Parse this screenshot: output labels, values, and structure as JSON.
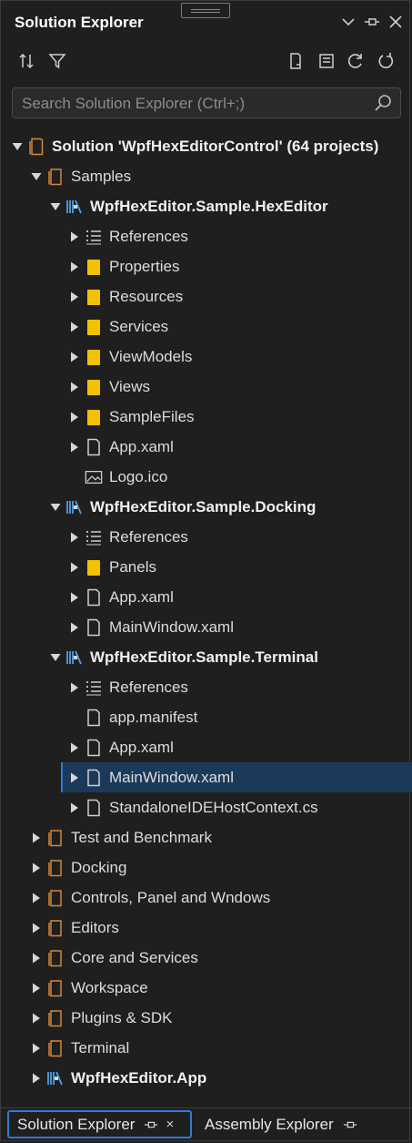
{
  "panel": {
    "title": "Solution Explorer"
  },
  "search": {
    "placeholder": "Search Solution Explorer (Ctrl+;)"
  },
  "tree": [
    {
      "label": "Solution 'WpfHexEditorControl' (64 projects)",
      "icon": "solution-icon",
      "expand": "open",
      "depth": 0,
      "bold": true
    },
    {
      "label": "Samples",
      "icon": "solution-folder-icon",
      "expand": "open",
      "depth": 1
    },
    {
      "label": "WpfHexEditor.Sample.HexEditor",
      "icon": "project-icon",
      "expand": "open",
      "depth": 2,
      "bold": true
    },
    {
      "label": "References",
      "icon": "references-icon",
      "expand": "closed",
      "depth": 3
    },
    {
      "label": "Properties",
      "icon": "folder-icon",
      "expand": "closed",
      "depth": 3
    },
    {
      "label": "Resources",
      "icon": "folder-icon",
      "expand": "closed",
      "depth": 3
    },
    {
      "label": "Services",
      "icon": "folder-icon",
      "expand": "closed",
      "depth": 3
    },
    {
      "label": "ViewModels",
      "icon": "folder-icon",
      "expand": "closed",
      "depth": 3
    },
    {
      "label": "Views",
      "icon": "folder-icon",
      "expand": "closed",
      "depth": 3
    },
    {
      "label": "SampleFiles",
      "icon": "folder-icon",
      "expand": "closed",
      "depth": 3
    },
    {
      "label": "App.xaml",
      "icon": "file-icon",
      "expand": "closed",
      "depth": 3
    },
    {
      "label": "Logo.ico",
      "icon": "image-file-icon",
      "expand": "none",
      "depth": 3
    },
    {
      "label": "WpfHexEditor.Sample.Docking",
      "icon": "project-icon",
      "expand": "open",
      "depth": 2,
      "bold": true
    },
    {
      "label": "References",
      "icon": "references-icon",
      "expand": "closed",
      "depth": 3
    },
    {
      "label": "Panels",
      "icon": "folder-icon",
      "expand": "closed",
      "depth": 3
    },
    {
      "label": "App.xaml",
      "icon": "file-icon",
      "expand": "closed",
      "depth": 3
    },
    {
      "label": "MainWindow.xaml",
      "icon": "file-icon",
      "expand": "closed",
      "depth": 3
    },
    {
      "label": "WpfHexEditor.Sample.Terminal",
      "icon": "project-icon",
      "expand": "open",
      "depth": 2,
      "bold": true
    },
    {
      "label": "References",
      "icon": "references-icon",
      "expand": "closed",
      "depth": 3
    },
    {
      "label": "app.manifest",
      "icon": "file-icon",
      "expand": "none",
      "depth": 3
    },
    {
      "label": "App.xaml",
      "icon": "file-icon",
      "expand": "closed",
      "depth": 3
    },
    {
      "label": "MainWindow.xaml",
      "icon": "file-icon",
      "expand": "closed",
      "depth": 3,
      "selected": true
    },
    {
      "label": "StandaloneIDEHostContext.cs",
      "icon": "file-icon",
      "expand": "closed",
      "depth": 3
    },
    {
      "label": "Test and Benchmark",
      "icon": "solution-folder-icon",
      "expand": "closed",
      "depth": 1
    },
    {
      "label": "Docking",
      "icon": "solution-folder-icon",
      "expand": "closed",
      "depth": 1
    },
    {
      "label": "Controls, Panel and Wndows",
      "icon": "solution-folder-icon",
      "expand": "closed",
      "depth": 1
    },
    {
      "label": "Editors",
      "icon": "solution-folder-icon",
      "expand": "closed",
      "depth": 1
    },
    {
      "label": "Core and Services",
      "icon": "solution-folder-icon",
      "expand": "closed",
      "depth": 1
    },
    {
      "label": "Workspace",
      "icon": "solution-folder-icon",
      "expand": "closed",
      "depth": 1
    },
    {
      "label": "Plugins & SDK",
      "icon": "solution-folder-icon",
      "expand": "closed",
      "depth": 1
    },
    {
      "label": "Terminal",
      "icon": "solution-folder-icon",
      "expand": "closed",
      "depth": 1
    },
    {
      "label": "WpfHexEditor.App",
      "icon": "project-icon",
      "expand": "closed",
      "depth": 1,
      "bold": true
    }
  ],
  "tabs": {
    "active_label": "Solution Explorer",
    "close_glyph": "×",
    "inactive_label": "Assembly Explorer"
  },
  "colors": {
    "background": "#1f1f1f",
    "selection": "#1b3a5a",
    "accent": "#2f7bd6",
    "folder": "#f2c200",
    "solution_folder": "#d4873a",
    "project": "#4f9de6"
  }
}
